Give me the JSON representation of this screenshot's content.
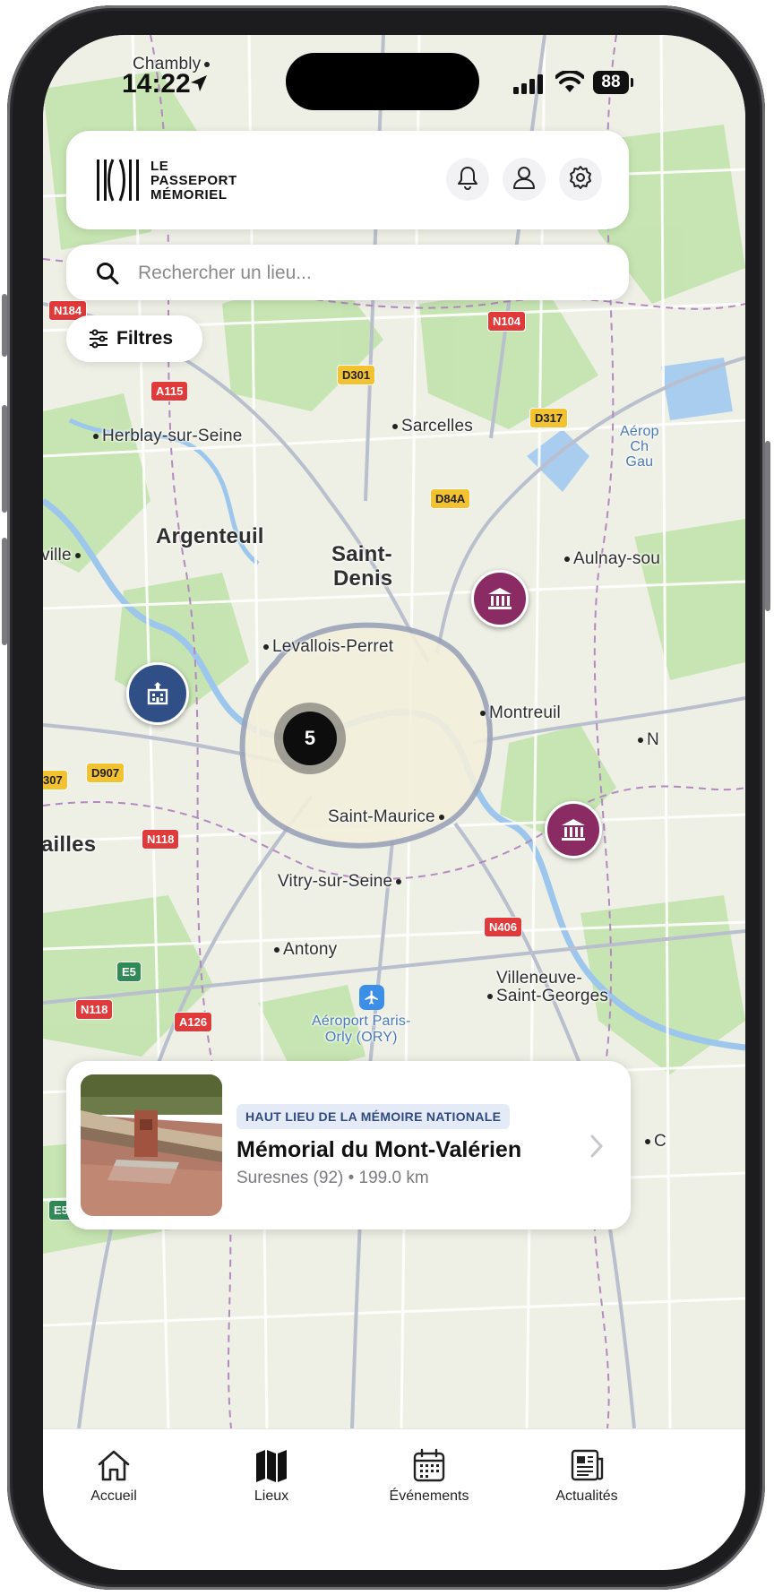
{
  "status_bar": {
    "time": "14:22",
    "battery": "88"
  },
  "header": {
    "logo_lines": [
      "LE",
      "PASSEPORT",
      "MÉMORIEL"
    ],
    "icons": [
      "bell-icon",
      "user-icon",
      "gear-icon"
    ]
  },
  "search": {
    "placeholder": "Rechercher un lieu..."
  },
  "filters": {
    "label": "Filtres"
  },
  "map": {
    "places": [
      "Chambly",
      "Herblay-sur-Seine",
      "Sarcelles",
      "Argenteuil",
      "Saint-",
      "Denis",
      "Aulnay-sou",
      "ville",
      "Levallois-Perret",
      "Montreuil",
      "N",
      "Saint-Maurice",
      "ailles",
      "Vitry-sur-Seine",
      "Antony",
      "Villeneuve-",
      "Saint-Georges",
      "C"
    ],
    "airports": {
      "orly_line1": "Aéroport Paris-",
      "orly_line2": "Orly (ORY)",
      "cdg_line1": "Aérop",
      "cdg_line2": "Ch",
      "cdg_line3": "Gau"
    },
    "roads": [
      "N184",
      "N104",
      "D301",
      "A115",
      "D317",
      "D84A",
      "D907",
      "307",
      "N118",
      "N406",
      "E5",
      "N118",
      "A126",
      "E5"
    ],
    "cluster_count": "5",
    "marker_icons": [
      "museum-icon",
      "building-icon"
    ]
  },
  "place_card": {
    "badge": "HAUT LIEU DE LA MÉMOIRE NATIONALE",
    "title": "Mémorial du Mont-Valérien",
    "subtitle": "Suresnes (92) • 199.0 km"
  },
  "tabs": [
    {
      "label": "Accueil",
      "icon": "home-icon"
    },
    {
      "label": "Lieux",
      "icon": "map-icon",
      "active": true
    },
    {
      "label": "Événements",
      "icon": "calendar-icon"
    },
    {
      "label": "Actualités",
      "icon": "news-icon"
    }
  ],
  "colors": {
    "marker_purple": "#8a2b63",
    "marker_blue": "#2f4f86",
    "map_base": "#eef0e6"
  }
}
